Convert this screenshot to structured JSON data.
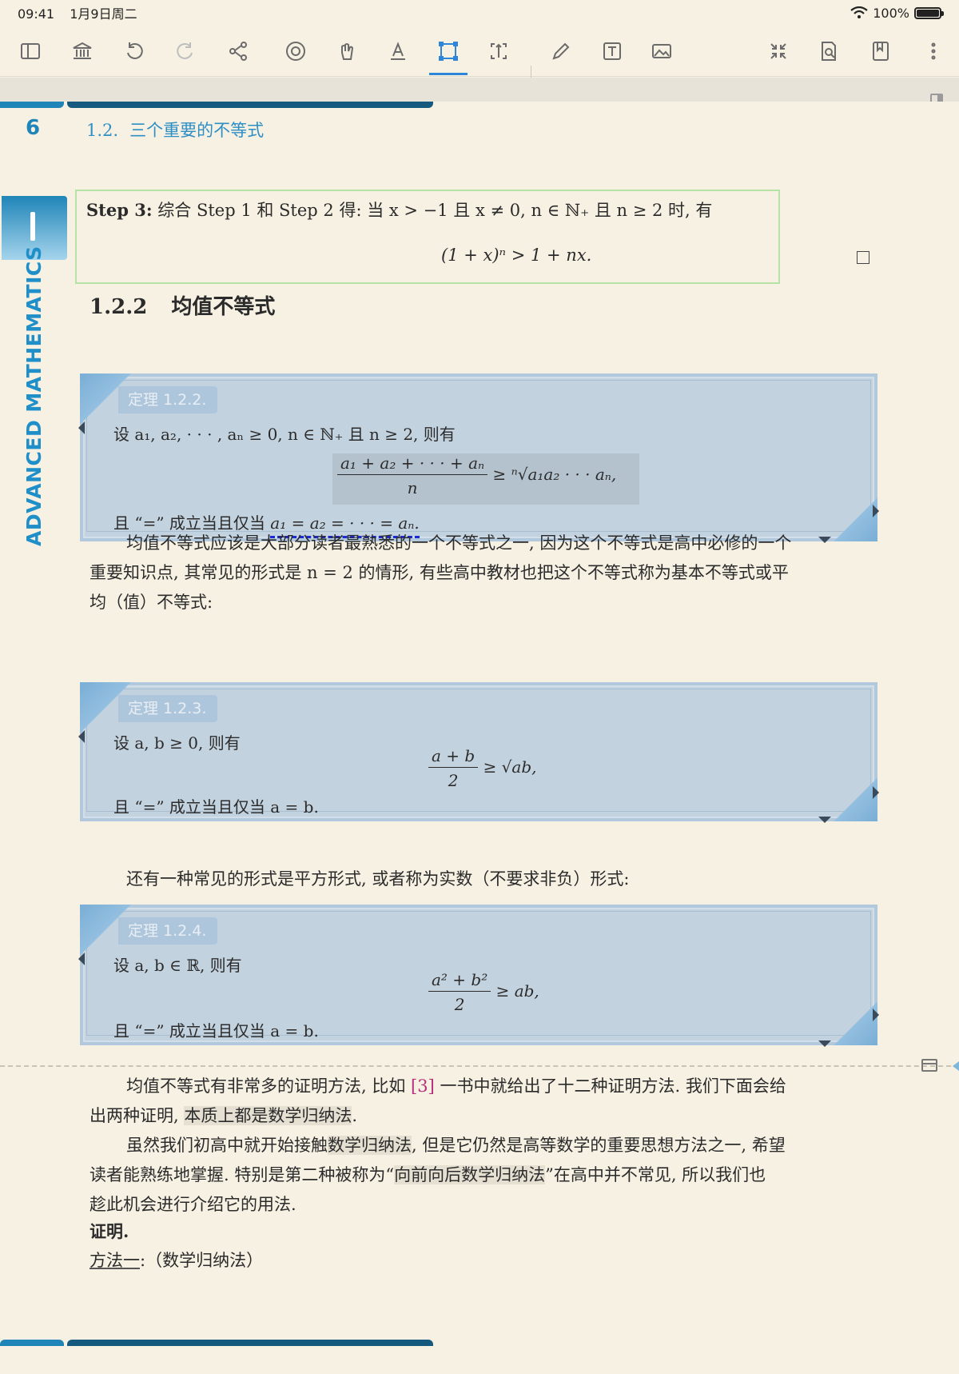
{
  "status_bar": {
    "time": "09:41",
    "date": "1月9日周二",
    "battery": "100%"
  },
  "toolbar": {
    "icons": [
      "sidebar-icon",
      "library-icon",
      "undo-icon",
      "redo-icon",
      "share-icon",
      "rotate-settings-icon",
      "hand-icon",
      "text-highlight-icon",
      "rectangle-select-icon",
      "crop-icon",
      "pen-icon",
      "textbox-icon",
      "image-icon",
      "collapse-icon",
      "search-doc-icon",
      "bookmark-icon",
      "more-icon"
    ],
    "active": "rectangle-select-icon"
  },
  "page": {
    "number": "6",
    "running_head_num": "1.2.",
    "running_head_title": "三个重要的不等式",
    "side_title": "ADVANCED MATHEMATICS"
  },
  "step3": {
    "label": "Step 3:",
    "text": "综合 Step 1 和 Step 2 得: 当 x > −1 且 x ≠ 0, n ∈ ℕ₊ 且 n ≥ 2 时, 有",
    "formula": "(1 + x)ⁿ > 1 + nx."
  },
  "section": {
    "number": "1.2.2",
    "title": "均值不等式"
  },
  "theorem_1": {
    "label": "定理 1.2.2.",
    "line1": "设 a₁, a₂, · · · , aₙ ≥ 0, n ∈ ℕ₊ 且 n ≥ 2, 则有",
    "numerator": "a₁ + a₂ + · · · + aₙ",
    "denominator": "n",
    "rhs": "≥ ⁿ√a₁a₂ · · · aₙ,",
    "equality_prefix": "且 “=” 成立当且仅当",
    "equality_cond": "a₁ = a₂ = · · · = aₙ."
  },
  "para_1": {
    "line1": "均值不等式应该是大部分读者最熟悉的一个不等式之一, 因为这个不等式是高中必修的一个",
    "line2": "重要知识点, 其常见的形式是 n = 2 的情形, 有些高中教材也把这个不等式称为基本不等式或平",
    "line3": "均（值）不等式:"
  },
  "theorem_2": {
    "label": "定理 1.2.3.",
    "line1": "设 a, b ≥ 0, 则有",
    "numerator": "a + b",
    "denominator": "2",
    "rhs": "≥ √ab,",
    "equality": "且 “=” 成立当且仅当 a = b."
  },
  "para_2": {
    "text": "还有一种常见的形式是平方形式, 或者称为实数（不要求非负）形式:"
  },
  "theorem_3": {
    "label": "定理 1.2.4.",
    "line1": "设 a, b ∈ ℝ, 则有",
    "numerator": "a² + b²",
    "denominator": "2",
    "rhs": "≥ ab,",
    "equality": "且 “=” 成立当且仅当 a = b."
  },
  "para_3": {
    "line1_a": "均值不等式有非常多的证明方法, 比如",
    "ref": "[3]",
    "line1_b": "一书中就给出了十二种证明方法. 我们下面会给",
    "line2_a": "出两种证明,",
    "line2_hl": "本质上都是数学归纳法",
    "line2_b": "."
  },
  "para_4": {
    "line1_a": "虽然我们初高中就开始接触",
    "line1_hl": "数学归纳法",
    "line1_b": ", 但是它仍然是高等数学的重要思想方法之一, 希望",
    "line2_a": "读者能熟练地掌握. 特别是第二种被称为“",
    "line2_hl": "向前向后数学归纳法",
    "line2_b": "”在高中并不常见, 所以我们也",
    "line3": "趁此机会进行介绍它的用法."
  },
  "proof": {
    "label": "证明.",
    "method_label": "方法一",
    "method_text": ":（数学归纳法）"
  }
}
